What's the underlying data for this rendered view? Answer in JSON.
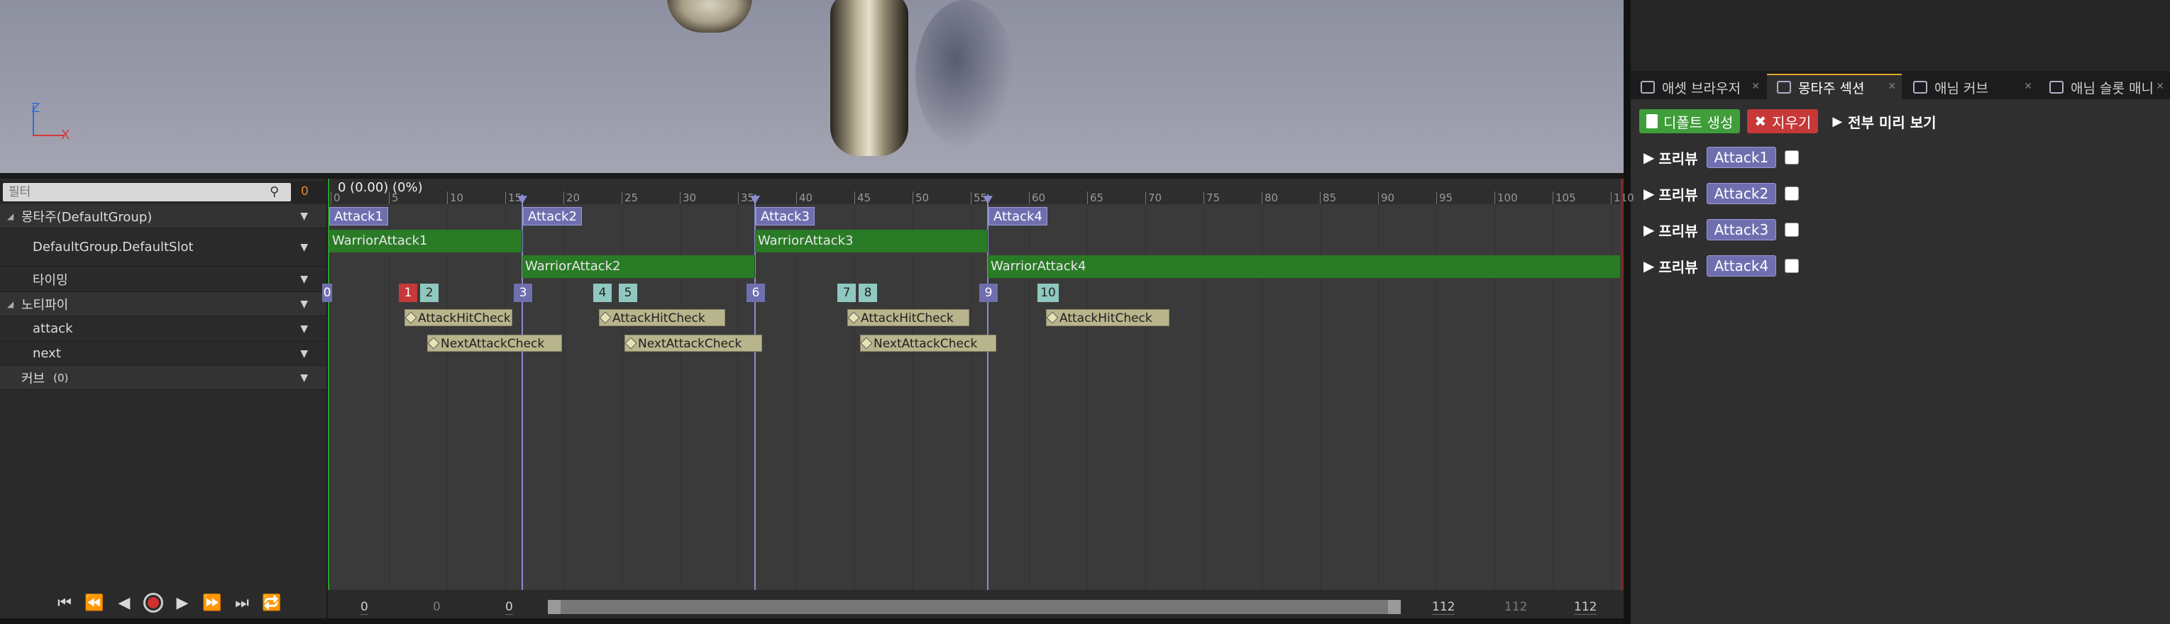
{
  "viewport": {
    "axis_z": "Z",
    "axis_x": "X"
  },
  "right_panel": {
    "tabs": [
      {
        "label": "애셋 브라우저",
        "icon": "grid-icon",
        "active": false
      },
      {
        "label": "몽타주 섹션",
        "icon": "montage-icon",
        "active": true
      },
      {
        "label": "애님 커브",
        "icon": "curve-icon",
        "active": false
      },
      {
        "label": "애님 슬롯 매니",
        "icon": "slot-icon",
        "active": false
      }
    ],
    "toolbar": {
      "create_default": "디폴트 생성",
      "clear": "지우기",
      "preview_all": "전부 미리 보기"
    },
    "sections": [
      {
        "preview": "프리뷰",
        "name": "Attack1"
      },
      {
        "preview": "프리뷰",
        "name": "Attack2"
      },
      {
        "preview": "프리뷰",
        "name": "Attack3"
      },
      {
        "preview": "프리뷰",
        "name": "Attack4"
      }
    ]
  },
  "tree": {
    "filter_placeholder": "필터",
    "filter_count": "0",
    "rows": {
      "montage": "몽타주(DefaultGroup)",
      "slot": "DefaultGroup.DefaultSlot",
      "timing": "타이밍",
      "notify": "노티파이",
      "attack": "attack",
      "next": "next",
      "curve": "커브",
      "curve_count": "(0)"
    }
  },
  "timeline": {
    "frame_readout": "0 (0.00) (0%)",
    "ticks": [
      "0",
      "5",
      "10",
      "15",
      "20",
      "25",
      "30",
      "35",
      "40",
      "45",
      "50",
      "55",
      "60",
      "65",
      "70",
      "75",
      "80",
      "85",
      "90",
      "95",
      "100",
      "105",
      "110"
    ],
    "sections": [
      "Attack1",
      "Attack2",
      "Attack3",
      "Attack4"
    ],
    "segments": [
      "WarriorAttack1",
      "WarriorAttack2",
      "WarriorAttack3",
      "WarriorAttack4"
    ],
    "timing_markers": [
      "0",
      "1",
      "2",
      "3",
      "4",
      "5",
      "6",
      "7",
      "8",
      "9",
      "10"
    ],
    "attack_notifies": [
      "AttackHitCheck",
      "AttackHitCheck",
      "AttackHitCheck",
      "AttackHitCheck"
    ],
    "next_notifies": [
      "NextAttackCheck",
      "NextAttackCheck",
      "NextAttackCheck"
    ],
    "range": {
      "start": "0",
      "start_dim": "0",
      "view_start": "0",
      "view_end": "112",
      "end_dim": "112",
      "end": "112"
    }
  },
  "colors": {
    "section": "#6f6fb0",
    "segment": "#2a7b26",
    "notify": "#b8b58c",
    "accent_orange": "#e0a62a",
    "red_marker": "#c73838",
    "teal_marker": "#8fc8c0"
  }
}
